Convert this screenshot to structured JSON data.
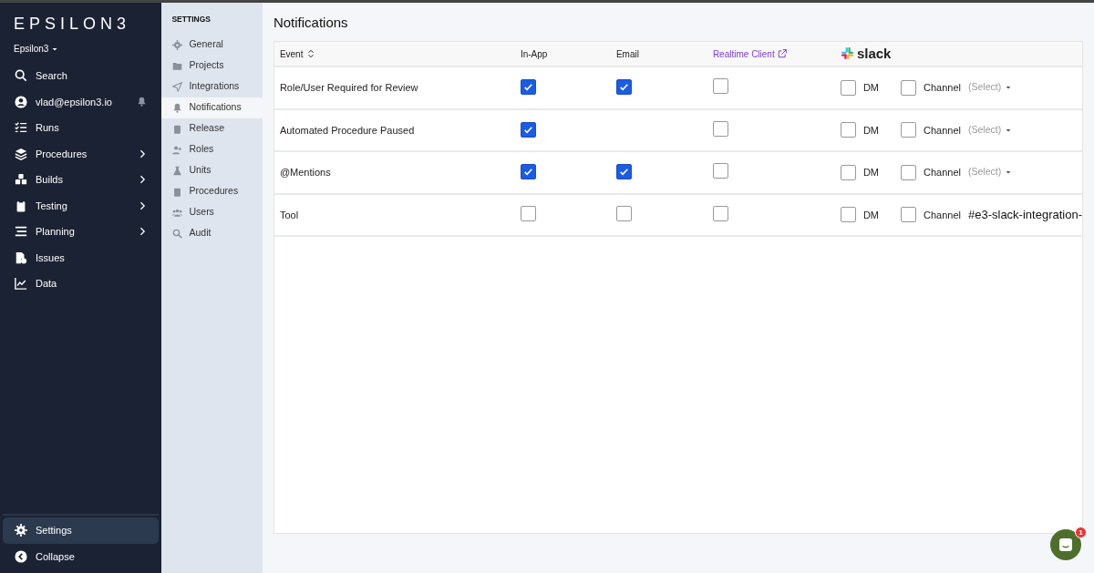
{
  "nav": {
    "logo": "EPSILON3",
    "workspace": "Epsilon3",
    "items": [
      {
        "label": "Search",
        "expandable": false,
        "kind": "plain"
      },
      {
        "label": "vlad@epsilon3.io",
        "expandable": false,
        "kind": "user"
      },
      {
        "label": "Runs",
        "expandable": false,
        "kind": "plain"
      },
      {
        "label": "Procedures",
        "expandable": true,
        "kind": "plain"
      },
      {
        "label": "Builds",
        "expandable": true,
        "kind": "plain"
      },
      {
        "label": "Testing",
        "expandable": true,
        "kind": "plain"
      },
      {
        "label": "Planning",
        "expandable": true,
        "kind": "plain"
      },
      {
        "label": "Issues",
        "expandable": false,
        "kind": "plain"
      },
      {
        "label": "Data",
        "expandable": false,
        "kind": "plain"
      }
    ],
    "bottom": [
      {
        "label": "Settings",
        "selected": true
      },
      {
        "label": "Collapse",
        "selected": false
      }
    ]
  },
  "settings": {
    "heading": "SETTINGS",
    "items": [
      {
        "label": "General",
        "selected": false
      },
      {
        "label": "Projects",
        "selected": false
      },
      {
        "label": "Integrations",
        "selected": false
      },
      {
        "label": "Notifications",
        "selected": true
      },
      {
        "label": "Release",
        "selected": false
      },
      {
        "label": "Roles",
        "selected": false
      },
      {
        "label": "Units",
        "selected": false
      },
      {
        "label": "Procedures",
        "selected": false
      },
      {
        "label": "Users",
        "selected": false
      },
      {
        "label": "Audit",
        "selected": false
      }
    ]
  },
  "page_title": "Notifications",
  "table": {
    "columns": {
      "event": "Event",
      "in_app": "In-App",
      "email": "Email",
      "realtime": "Realtime Client",
      "slack": "slack"
    },
    "rows": [
      {
        "event": "Role/User Required for Review",
        "in_app": true,
        "email": true,
        "realtime": false,
        "dm_label": "DM",
        "dm": false,
        "channel_label": "Channel",
        "channel": false,
        "channel_placeholder": "(Select)"
      },
      {
        "event": "Automated Procedure Paused",
        "in_app": true,
        "realtime": false,
        "dm_label": "DM",
        "dm": false,
        "channel_label": "Channel",
        "channel": false,
        "channel_placeholder": "(Select)"
      },
      {
        "event": "@Mentions",
        "in_app": true,
        "email": true,
        "realtime": false,
        "dm_label": "DM",
        "dm": false,
        "channel_label": "Channel",
        "channel": false,
        "channel_placeholder": "(Select)"
      },
      {
        "event": "Tool",
        "in_app": false,
        "email": false,
        "realtime": false,
        "dm_label": "DM",
        "dm": false,
        "channel_label": "Channel",
        "channel": false,
        "channel_value": "#e3-slack-integration-"
      }
    ]
  },
  "chat": {
    "badge": "1"
  }
}
